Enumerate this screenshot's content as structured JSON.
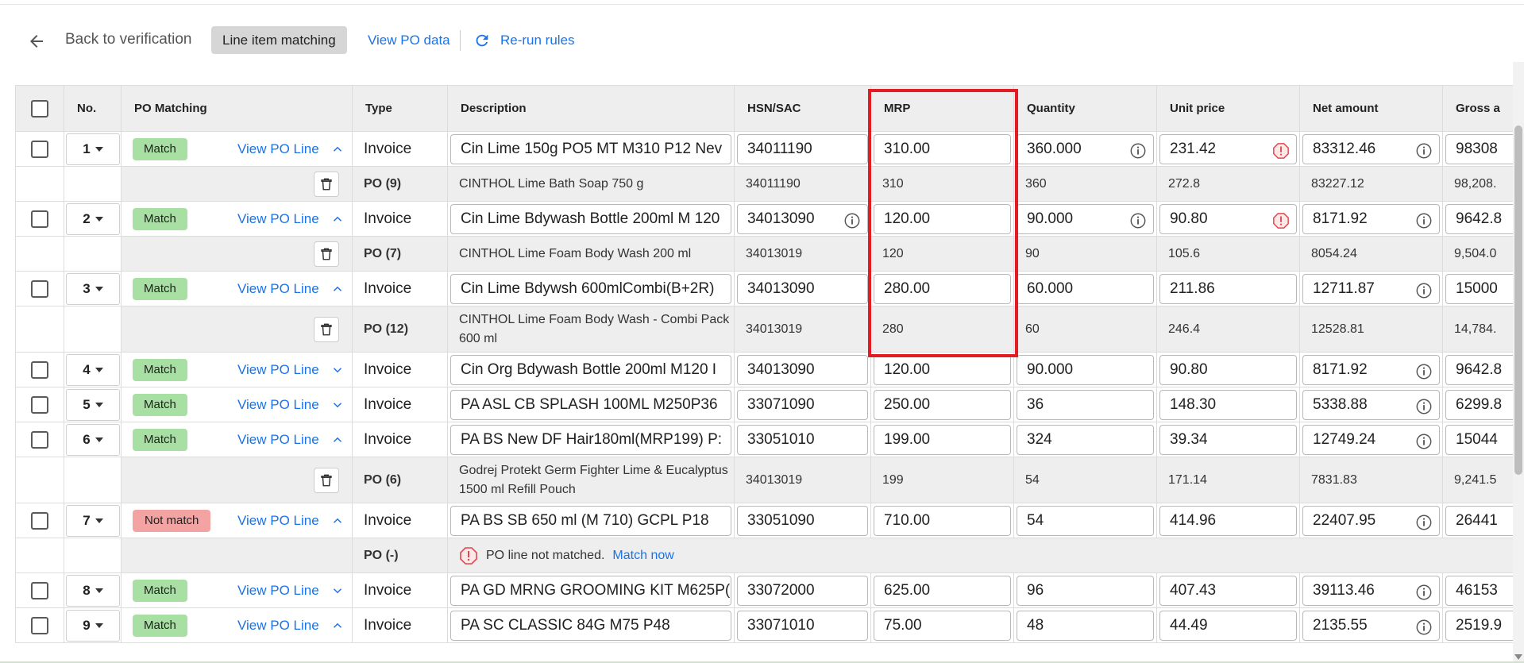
{
  "toolbar": {
    "back_label": "Back to verification",
    "tab_active": "Line item matching",
    "view_po_data": "View PO data",
    "rerun_rules": "Re-run rules"
  },
  "table": {
    "headers": {
      "no": "No.",
      "po_matching": "PO Matching",
      "type": "Type",
      "description": "Description",
      "hsn": "HSN/SAC",
      "mrp": "MRP",
      "quantity": "Quantity",
      "unit_price": "Unit price",
      "net_amount": "Net amount",
      "gross_amount": "Gross a"
    },
    "view_po_line_label": "View PO Line",
    "match_label": "Match",
    "not_match_label": "Not match",
    "invoice_label": "Invoice",
    "rows": [
      {
        "no": "1",
        "status": "Match",
        "expanded": true,
        "type": "Invoice",
        "description": "Cin Lime 150g PO5 MT M310 P12 Nev",
        "hsn": "34011190",
        "mrp": "310.00",
        "quantity": "360.000",
        "unit_price": "231.42",
        "net_amount": "83312.46",
        "gross_amount": "98308",
        "po": {
          "type": "PO (9)",
          "description": "CINTHOL Lime Bath Soap 750 g",
          "hsn": "34011190",
          "mrp": "310",
          "quantity": "360",
          "unit_price": "272.8",
          "net_amount": "83227.12",
          "gross_amount": "98,208."
        }
      },
      {
        "no": "2",
        "status": "Match",
        "expanded": true,
        "type": "Invoice",
        "description": "Cin Lime Bdywash Bottle 200ml M 120",
        "hsn": "34013090",
        "mrp": "120.00",
        "quantity": "90.000",
        "unit_price": "90.80",
        "net_amount": "8171.92",
        "gross_amount": "9642.8",
        "po": {
          "type": "PO (7)",
          "description": "CINTHOL Lime Foam Body Wash 200 ml",
          "hsn": "34013019",
          "mrp": "120",
          "quantity": "90",
          "unit_price": "105.6",
          "net_amount": "8054.24",
          "gross_amount": "9,504.0"
        }
      },
      {
        "no": "3",
        "status": "Match",
        "expanded": true,
        "type": "Invoice",
        "description": "Cin Lime Bdywsh 600mlCombi(B+2R)",
        "hsn": "34013090",
        "mrp": "280.00",
        "quantity": "60.000",
        "unit_price": "211.86",
        "net_amount": "12711.87",
        "gross_amount": "15000",
        "po": {
          "type": "PO (12)",
          "description": "CINTHOL Lime Foam Body Wash - Combi Pack 600 ml",
          "hsn": "34013019",
          "mrp": "280",
          "quantity": "60",
          "unit_price": "246.4",
          "net_amount": "12528.81",
          "gross_amount": "14,784."
        }
      },
      {
        "no": "4",
        "status": "Match",
        "expanded": false,
        "type": "Invoice",
        "description": "Cin Org Bdywash Bottle 200ml M120 I",
        "hsn": "34013090",
        "mrp": "120.00",
        "quantity": "90.000",
        "unit_price": "90.80",
        "net_amount": "8171.92",
        "gross_amount": "9642.8"
      },
      {
        "no": "5",
        "status": "Match",
        "expanded": false,
        "type": "Invoice",
        "description": "PA ASL CB SPLASH 100ML M250P36",
        "hsn": "33071090",
        "mrp": "250.00",
        "quantity": "36",
        "unit_price": "148.30",
        "net_amount": "5338.88",
        "gross_amount": "6299.8"
      },
      {
        "no": "6",
        "status": "Match",
        "expanded": true,
        "type": "Invoice",
        "description": "PA BS New DF Hair180ml(MRP199) P:",
        "hsn": "33051010",
        "mrp": "199.00",
        "quantity": "324",
        "unit_price": "39.34",
        "net_amount": "12749.24",
        "gross_amount": "15044",
        "po": {
          "type": "PO (6)",
          "description": "Godrej Protekt Germ Fighter Lime & Eucalyptus 1500 ml Refill Pouch",
          "hsn": "34013019",
          "mrp": "199",
          "quantity": "54",
          "unit_price": "171.14",
          "net_amount": "7831.83",
          "gross_amount": "9,241.5"
        }
      },
      {
        "no": "7",
        "status": "Not match",
        "expanded": true,
        "type": "Invoice",
        "description": "PA BS SB 650 ml (M 710) GCPL P18",
        "hsn": "33051090",
        "mrp": "710.00",
        "quantity": "54",
        "unit_price": "414.96",
        "net_amount": "22407.95",
        "gross_amount": "26441",
        "po_unmatched": {
          "type": "PO (-)",
          "message": "PO line not matched.",
          "link": "Match now"
        }
      },
      {
        "no": "8",
        "status": "Match",
        "expanded": false,
        "type": "Invoice",
        "description": "PA GD MRNG GROOMING KIT M625P(",
        "hsn": "33072000",
        "mrp": "625.00",
        "quantity": "96",
        "unit_price": "407.43",
        "net_amount": "39113.46",
        "gross_amount": "46153"
      },
      {
        "no": "9",
        "status": "Match",
        "expanded": true,
        "type": "Invoice",
        "description": "PA SC CLASSIC 84G M75 P48",
        "hsn": "33071010",
        "mrp": "75.00",
        "quantity": "48",
        "unit_price": "44.49",
        "net_amount": "2135.55",
        "gross_amount": "2519.9"
      }
    ]
  },
  "colors": {
    "link": "#1a73e8",
    "match_badge": "#a8dfa3",
    "not_match_badge": "#f4a3a3",
    "highlight_border": "#e31b23",
    "warning": "#e0474f"
  }
}
